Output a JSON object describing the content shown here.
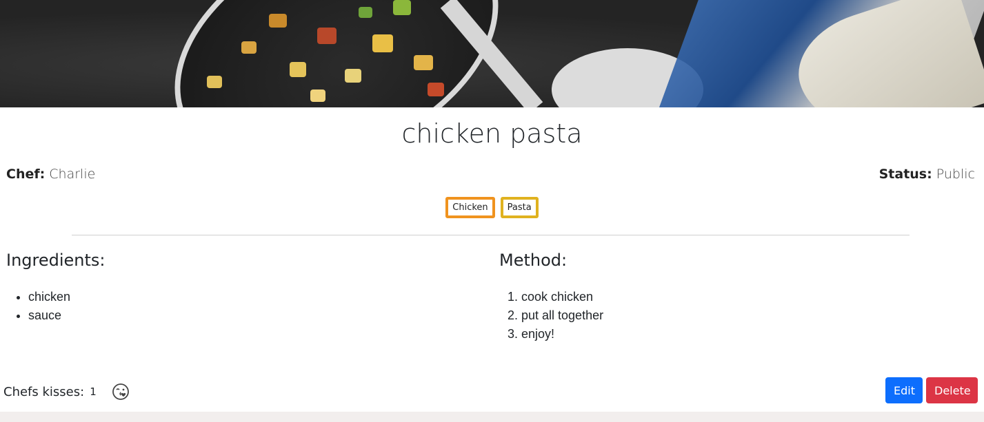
{
  "recipe": {
    "title": "chicken pasta",
    "chef_label": "Chef:",
    "chef_name": "Charlie",
    "status_label": "Status:",
    "status_value": "Public"
  },
  "tags": [
    {
      "label": "Chicken",
      "color": "#f0931e"
    },
    {
      "label": "Pasta",
      "color": "#e0b21f"
    }
  ],
  "ingredients": {
    "title": "Ingredients:",
    "items": [
      "chicken",
      "sauce"
    ]
  },
  "method": {
    "title": "Method:",
    "steps": [
      "cook chicken",
      "put all together",
      "enjoy!"
    ]
  },
  "kisses": {
    "label": "Chefs kisses:",
    "count": "1",
    "icon": "kiss-emoji-icon"
  },
  "actions": {
    "edit_label": "Edit",
    "delete_label": "Delete"
  },
  "colors": {
    "edit": "#0d6efd",
    "delete": "#dc3545"
  }
}
